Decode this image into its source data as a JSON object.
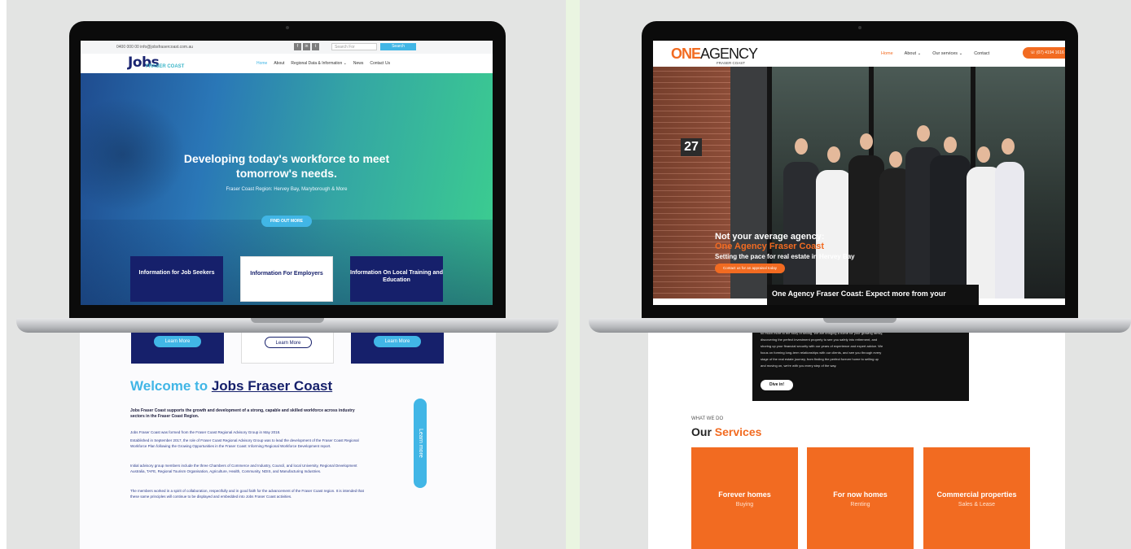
{
  "left_site": {
    "topbar": {
      "contact": "0400 000 00  info@jobsfrasercoast.com.au",
      "search_placeholder": "Search For",
      "search_button": "Search",
      "social": [
        "f",
        "in",
        "t"
      ]
    },
    "logo": {
      "word": "Jobs",
      "sub": "FRASER COAST"
    },
    "nav": [
      "Home",
      "About",
      "Regional Data & Information ⌄",
      "News",
      "Contact Us"
    ],
    "hero": {
      "title_line1": "Developing today's workforce to meet",
      "title_line2": "tomorrow's needs.",
      "subtitle": "Fraser Coast Region: Hervey Bay, Maryborough & More",
      "button": "FIND OUT MORE"
    },
    "cards": [
      {
        "label": "Information for Job Seekers",
        "button": "Learn More"
      },
      {
        "label": "Information For Employers",
        "button": "Learn More"
      },
      {
        "label": "Information On Local Training and Education",
        "button": "Learn More"
      }
    ],
    "welcome": {
      "prefix": "Welcome to ",
      "name": "Jobs Fraser Coast"
    },
    "intro": "Jobs Fraser Coast supports the growth and development of a strong, capable and skilled workforce across industry sectors in the Fraser Coast Region.",
    "paragraphs": [
      "Jobs Fraser Coast was formed from the Fraser Coast Regional Advisory Group in May 2018.",
      "Established in September 2017, the role of Fraser Coast Regional Advisory Group was to lead the development of the Fraser Coast Regional Workforce Plan following the Growing Opportunities in the Fraser Coast: Informing Regional Workforce Development report.",
      "Initial advisory group members include the three Chambers of Commerce and Industry, Council, and local University, Regional Development Australia, TAFE, Regional Tourism Organisation, Agriculture, Health, Community, NDIS, and Manufacturing Industries.",
      "The members worked in a spirit of collaboration, respectfully and in good faith for the advancement of the Fraser Coast region. It is intended that these same principles will continue to be displayed and embedded into Jobs Fraser Coast activities."
    ],
    "side_button": "Learn more"
  },
  "right_site": {
    "logo": {
      "one": "ONE",
      "agency": "AGENCY",
      "sub": "FRASER COAST"
    },
    "nav": [
      "Home",
      "About ⌄",
      "Our services ⌄",
      "Contact"
    ],
    "phone_button": "☏ (07) 4194 1616",
    "house_number": "27",
    "hero": {
      "line1": "Not your average agency:",
      "line2": "One Agency Fraser Coast",
      "line3": "Setting the pace for real estate in Hervey Bay",
      "button": "Contact us for an appraisal today"
    },
    "black_heading": "One Agency Fraser Coast: Expect more from your",
    "black_text": [
      "so much more to the story of selling. We are bringing a home for your growing family,",
      "discovering the perfect investment property to see you safely into retirement, and",
      "shoring up your financial security with our years of experience and expert advice. We",
      "focus on forming long-term relationships with our clients, and see you through every",
      "stage of the real estate journey, from finding the perfect forever home to selling up",
      "and moving on, we're with you every step of the way."
    ],
    "dive_button": "Dive in!",
    "what_we_do": "WHAT WE DO",
    "our": "Our ",
    "services": "Services",
    "service_cards": [
      {
        "title": "Forever homes",
        "sub": "Buying"
      },
      {
        "title": "For now homes",
        "sub": "Renting"
      },
      {
        "title": "Commercial properties",
        "sub": "Sales & Lease"
      }
    ]
  },
  "colors": {
    "jobs_navy": "#16206b",
    "jobs_cyan": "#41b6e6",
    "agency_orange": "#f26b21"
  }
}
